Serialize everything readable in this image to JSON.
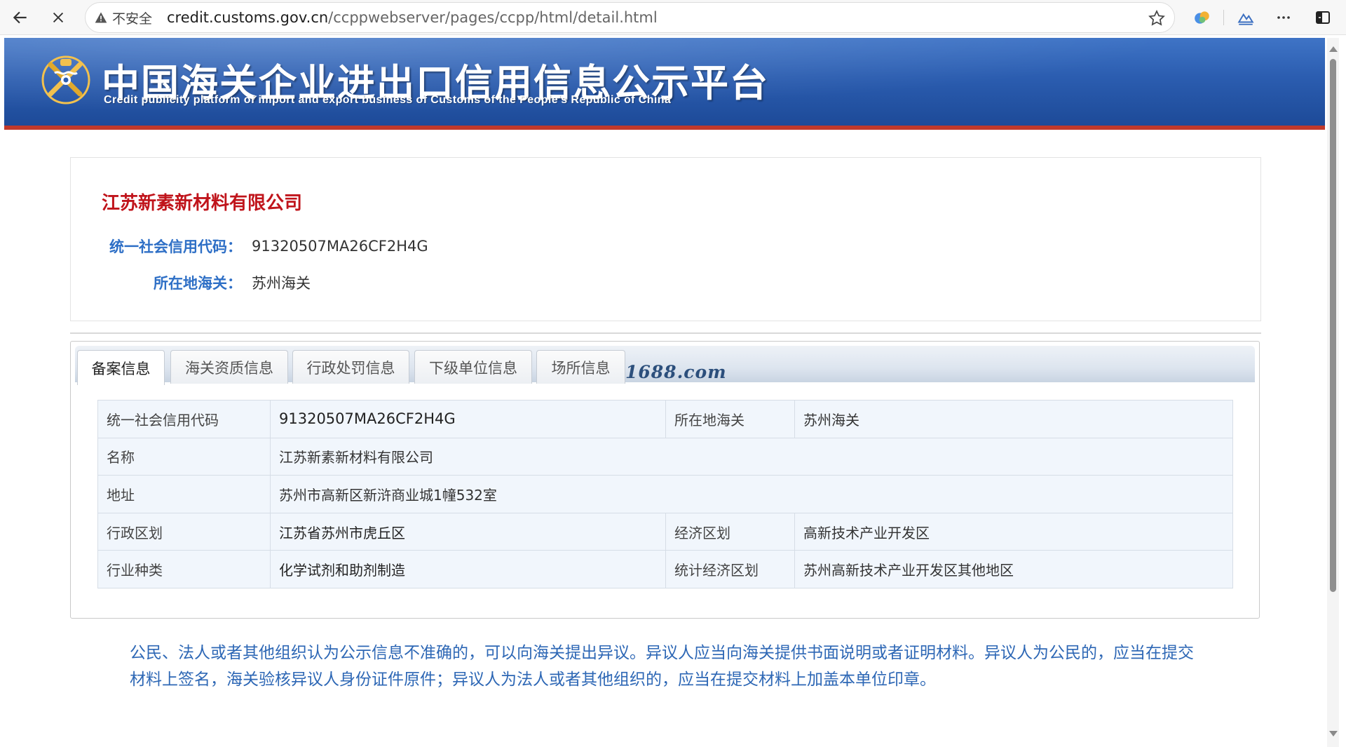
{
  "browser": {
    "insecure_label": "不安全",
    "url_host": "credit.customs.gov.cn",
    "url_path": "/ccppwebserver/pages/ccpp/html/detail.html"
  },
  "header": {
    "title": "中国海关企业进出口信用信息公示平台",
    "subtitle": "Credit publicity platform of import and export business of Customs of the People's Republic of China"
  },
  "company": {
    "name": "江苏新素新材料有限公司",
    "credit_code_label": "统一社会信用代码：",
    "credit_code": "91320507MA26CF2H4G",
    "customs_label": "所在地海关：",
    "customs": "苏州海关"
  },
  "tabs": [
    {
      "label": "备案信息",
      "active": true
    },
    {
      "label": "海关资质信息",
      "active": false
    },
    {
      "label": "行政处罚信息",
      "active": false
    },
    {
      "label": "下级单位信息",
      "active": false
    },
    {
      "label": "场所信息",
      "active": false
    }
  ],
  "watermark": "1688.com",
  "table": {
    "rows": [
      {
        "label": "统一社会信用代码",
        "value": "91320507MA26CF2H4G",
        "label2": "所在地海关",
        "value2": "苏州海关"
      },
      {
        "label": "名称",
        "value": "江苏新素新材料有限公司"
      },
      {
        "label": "地址",
        "value": "苏州市高新区新浒商业城1幢532室"
      },
      {
        "label": "行政区划",
        "value": "江苏省苏州市虎丘区",
        "label2": "经济区划",
        "value2": "高新技术产业开发区"
      },
      {
        "label": "行业种类",
        "value": "化学试剂和助剂制造",
        "label2": "统计经济区划",
        "value2": "苏州高新技术产业开发区其他地区"
      }
    ]
  },
  "notice": "公民、法人或者其他组织认为公示信息不准确的，可以向海关提出异议。异议人应当向海关提供书面说明或者证明材料。异议人为公民的，应当在提交材料上签名，海关验核异议人身份证件原件；异议人为法人或者其他组织的，应当在提交材料上加盖本单位印章。",
  "colors": {
    "banner_blue": "#2b5db0",
    "banner_red_rule": "#c0392b",
    "company_name_red": "#c0141b",
    "label_blue": "#2e6fc6",
    "notice_blue": "#2d67b5",
    "table_bg": "#f1f6fc"
  }
}
